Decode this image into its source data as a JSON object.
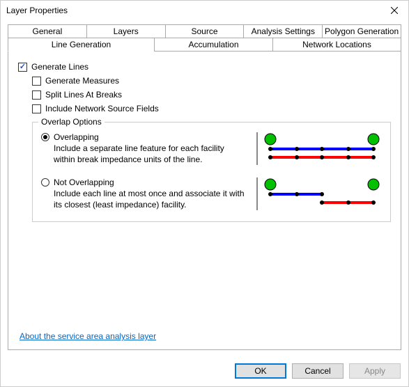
{
  "window": {
    "title": "Layer Properties"
  },
  "tabs_row1": [
    "General",
    "Layers",
    "Source",
    "Analysis Settings",
    "Polygon Generation"
  ],
  "tabs_row2": [
    "Line Generation",
    "Accumulation",
    "Network Locations"
  ],
  "active_tab": "Line Generation",
  "checkboxes": {
    "generate_lines": {
      "label": "Generate Lines",
      "checked": true
    },
    "generate_measures": {
      "label": "Generate Measures",
      "checked": false
    },
    "split_breaks": {
      "label": "Split Lines At Breaks",
      "checked": false
    },
    "include_nsf": {
      "label": "Include Network Source Fields",
      "checked": false
    }
  },
  "overlap_group": {
    "legend": "Overlap Options",
    "overlapping": {
      "label": "Overlapping",
      "desc": "Include a separate line feature for each facility within break impedance units of the line.",
      "selected": true
    },
    "not_overlapping": {
      "label": "Not Overlapping",
      "desc": "Include each line at most once and associate it with its closest (least impedance) facility.",
      "selected": false
    }
  },
  "help_link": "About the service area analysis layer",
  "buttons": {
    "ok": "OK",
    "cancel": "Cancel",
    "apply": "Apply"
  }
}
